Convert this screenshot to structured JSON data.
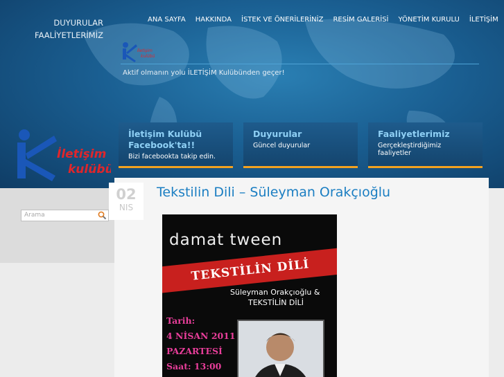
{
  "nav": {
    "items": [
      "ANA SAYFA",
      "HAKKINDA",
      "İSTEK VE ÖNERİLERİNİZ",
      "RESİM GALERİSİ",
      "YÖNETİM KURULU",
      "İLETİŞİM"
    ]
  },
  "left_links": [
    "DUYURULAR",
    "FAALİYETLERİMİZ"
  ],
  "tagline": "Aktif olmanın yolu İLETİŞİM Kulübünden geçer!",
  "cards": [
    {
      "title": "İletişim Kulübü Facebook'ta!!",
      "desc": "Bizi facebookta takip edin."
    },
    {
      "title": "Duyurular",
      "desc": "Güncel duyurular"
    },
    {
      "title": "Faaliyetlerimiz",
      "desc": "Gerçekleştirdiğimiz faaliyetler"
    }
  ],
  "logo": {
    "line1": "İletişim",
    "line2": "kulübü",
    "small1": "İletişim",
    "small2": "kulübü"
  },
  "search": {
    "placeholder": "Arama"
  },
  "post": {
    "day": "02",
    "month": "NIS",
    "title": "Tekstilin Dili – Süleyman Orakçıoğlu"
  },
  "poster": {
    "brand": "damat tween",
    "banner": "TEKSTİLİN DİLİ",
    "sub1": "Süleyman Orakçıoğlu &",
    "sub2": "TEKSTİLİN DİLİ",
    "lines": [
      "Tarih:",
      "4 NİSAN 2011",
      "PAZARTESİ",
      "Saat: 13:00"
    ]
  },
  "colors": {
    "accent": "#1b7ec2",
    "card_border": "#f3a21f",
    "logo_red": "#e0262b",
    "logo_blue": "#1a57b8"
  }
}
